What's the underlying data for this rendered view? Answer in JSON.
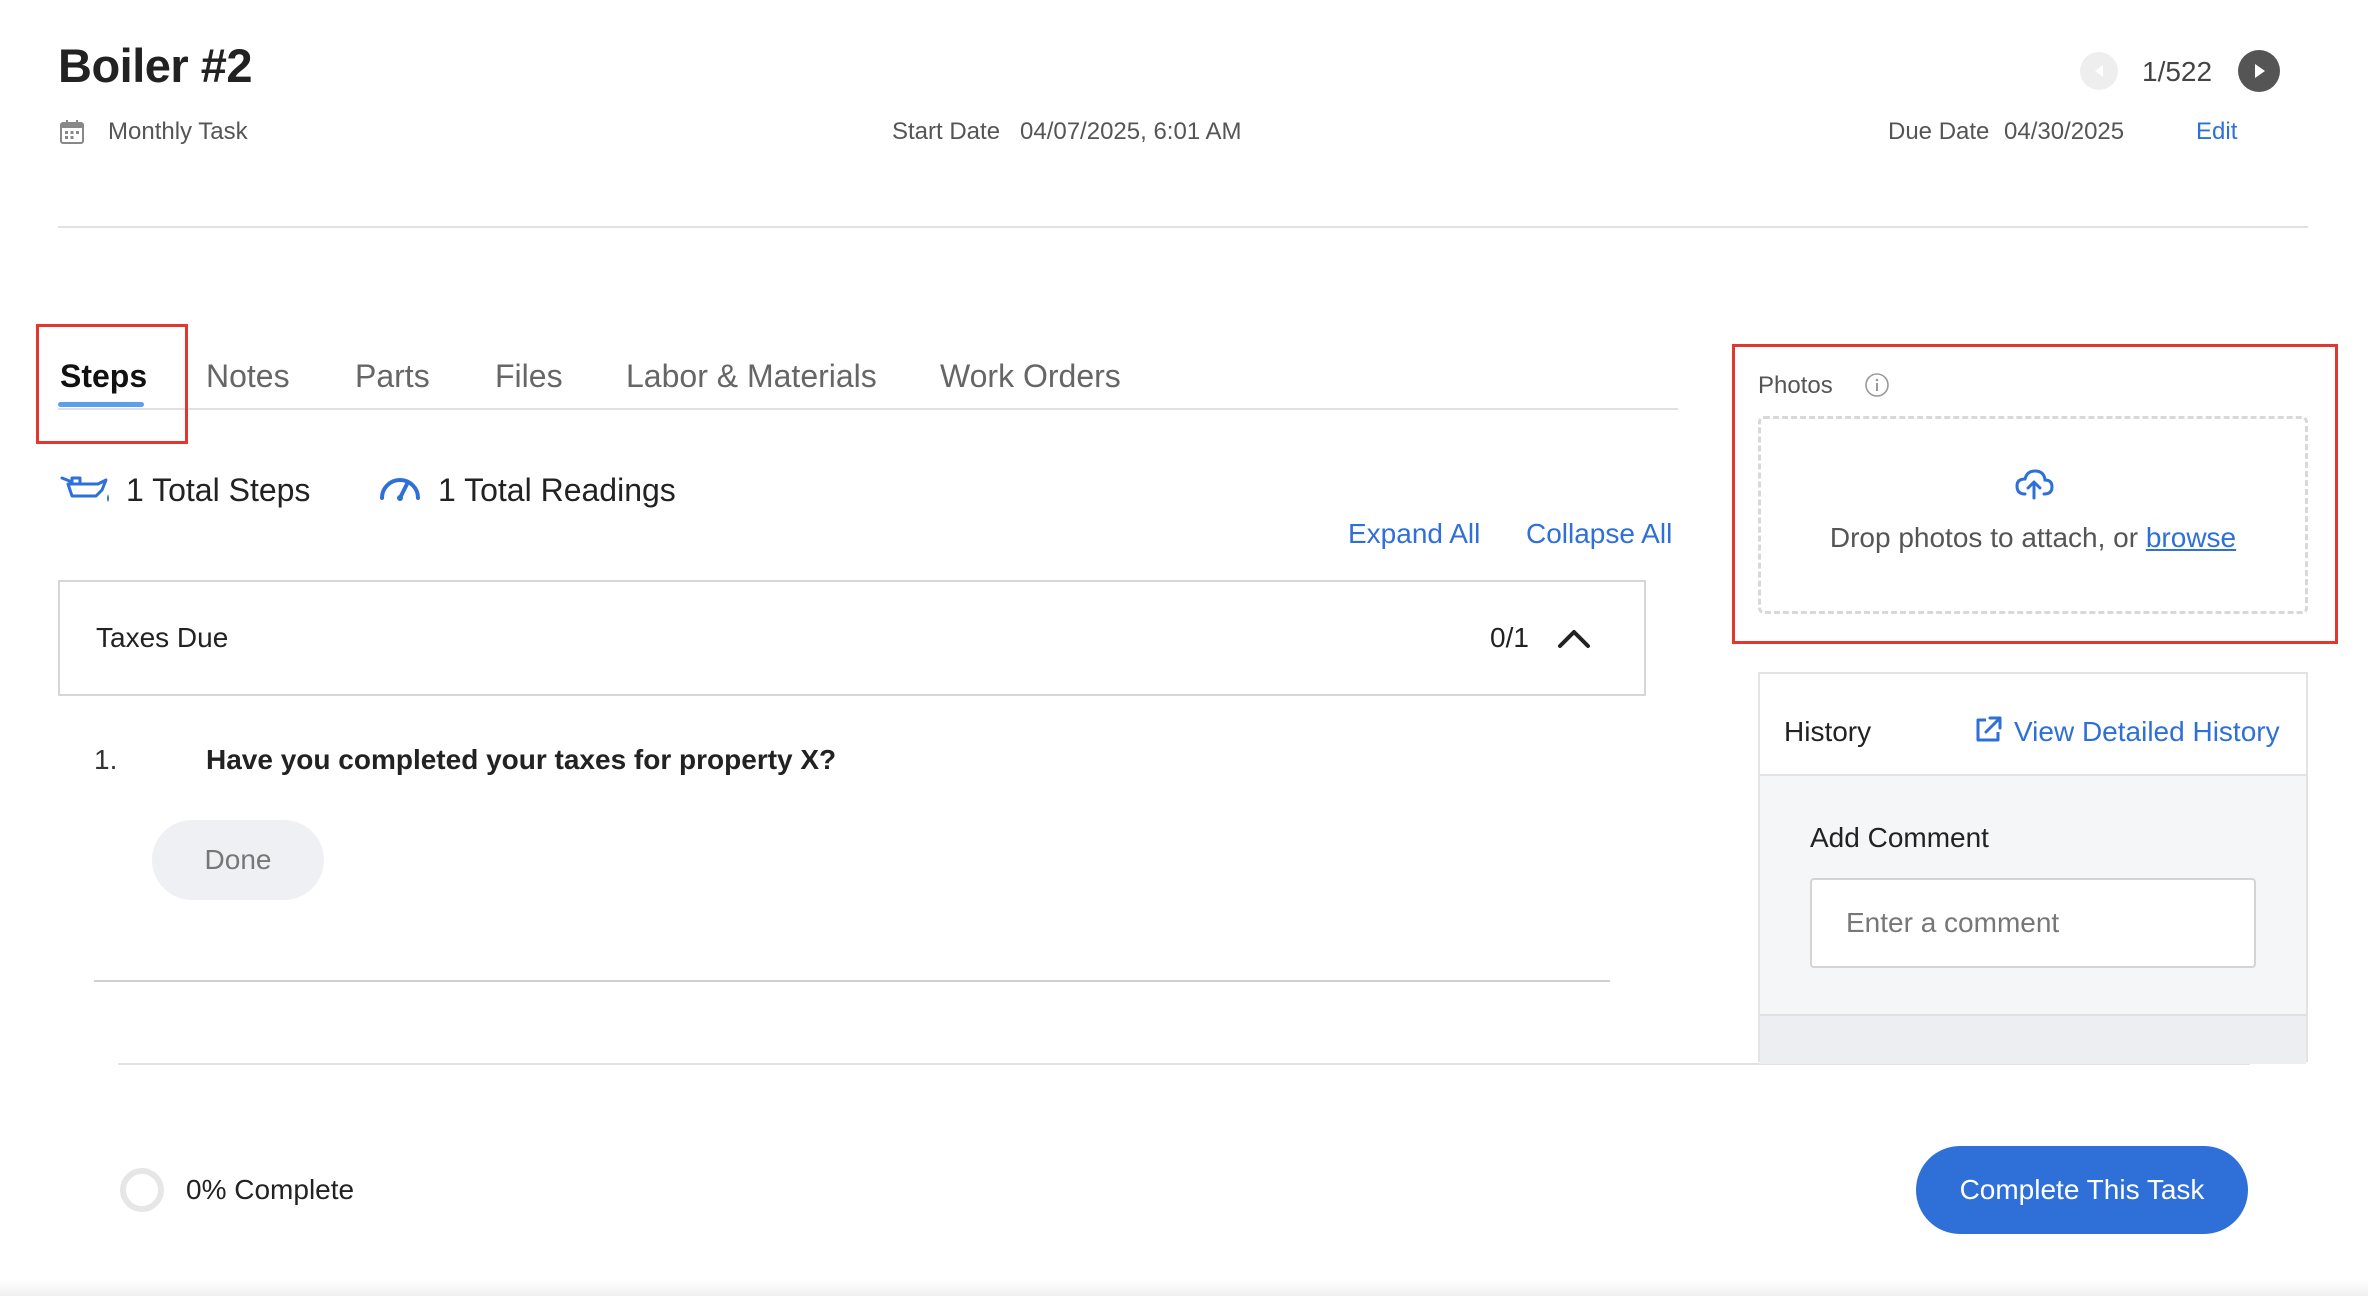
{
  "header": {
    "title": "Boiler #2",
    "task_type": "Monthly Task",
    "start_label": "Start Date",
    "start_value": "04/07/2025, 6:01 AM",
    "due_label": "Due Date",
    "due_value": "04/30/2025",
    "edit_label": "Edit",
    "counter": "1/522",
    "icons": {
      "calendar": "calendar-icon",
      "prev": "prev-arrow-icon",
      "next": "next-arrow-icon"
    }
  },
  "tabs": [
    {
      "label": "Steps",
      "active": true
    },
    {
      "label": "Notes",
      "active": false
    },
    {
      "label": "Parts",
      "active": false
    },
    {
      "label": "Files",
      "active": false
    },
    {
      "label": "Labor & Materials",
      "active": false
    },
    {
      "label": "Work Orders",
      "active": false
    }
  ],
  "totals": {
    "steps": "1 Total Steps",
    "readings": "1 Total Readings",
    "expand_all": "Expand All",
    "collapse_all": "Collapse All"
  },
  "step_group": {
    "name": "Taxes Due",
    "progress": "0/1",
    "steps": [
      {
        "number": "1.",
        "question": "Have you completed your taxes for property X?",
        "button": "Done"
      }
    ]
  },
  "photos": {
    "label": "Photos",
    "drop_text": "Drop photos to attach, or ",
    "browse": "browse"
  },
  "history": {
    "title": "History",
    "link": "View Detailed History",
    "add_comment_label": "Add Comment",
    "comment_placeholder": "Enter a comment"
  },
  "footer": {
    "progress_percent": 0,
    "progress_text": "0% Complete",
    "complete_button": "Complete This Task"
  },
  "colors": {
    "accent": "#2e6fd8",
    "tab_underline": "#5aa0ea",
    "highlight_border": "#e0382e",
    "done_button_bg": "#eef0f4"
  }
}
